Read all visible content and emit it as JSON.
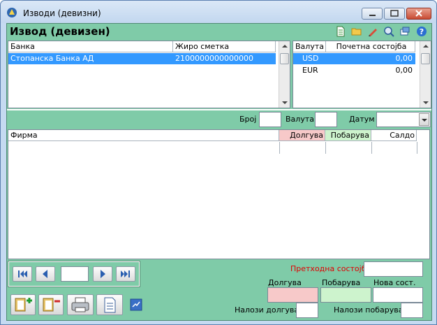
{
  "window": {
    "title": "Изводи (девизни)"
  },
  "page": {
    "title": "Извод (девизен)"
  },
  "toolbar_icons": [
    "new-document-icon",
    "open-folder-icon",
    "edit-pencil-icon",
    "preview-icon",
    "restore-window-icon",
    "help-icon"
  ],
  "banks_table": {
    "columns": [
      "Банка",
      "Жиро сметка"
    ],
    "rows": [
      {
        "bank": "Стопанска Банка АД",
        "account": "2100000000000000"
      }
    ]
  },
  "currency_table": {
    "columns": [
      "Валута",
      "Почетна состојба"
    ],
    "rows": [
      {
        "currency": "USD",
        "balance": "0,00"
      },
      {
        "currency": "EUR",
        "balance": "0,00"
      }
    ]
  },
  "filters": {
    "number_label": "Број",
    "currency_label": "Валута",
    "date_label": "Датум"
  },
  "items_table": {
    "columns": [
      "Фирма",
      "Долгува",
      "Побарува",
      "Салдо"
    ]
  },
  "summary": {
    "previous_balance_label": "Претходна состојба",
    "debit_label": "Долгува",
    "credit_label": "Побарува",
    "new_balance_label": "Нова сост.",
    "debit_orders_label": "Налози долгува",
    "credit_orders_label": "Налози побарува"
  },
  "colors": {
    "panel": "#7fcba8",
    "selection": "#3399ff",
    "debit_bg": "#f7c9c9",
    "credit_bg": "#cdf3cd",
    "previous_balance": "#e00000"
  }
}
